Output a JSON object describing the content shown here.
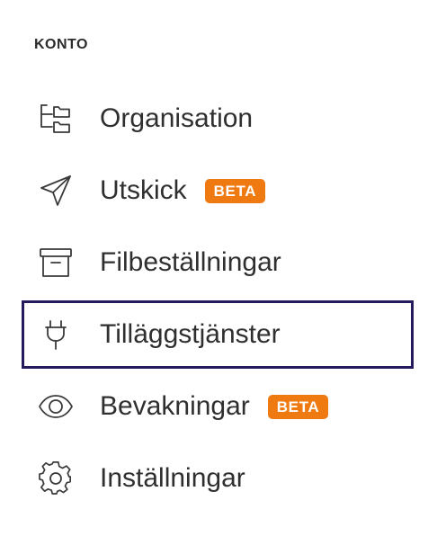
{
  "section": {
    "title": "KONTO"
  },
  "menu": {
    "items": [
      {
        "label": "Organisation",
        "icon": "folder-tree-icon",
        "badge": ""
      },
      {
        "label": "Utskick",
        "icon": "paper-plane-icon",
        "badge": "BETA"
      },
      {
        "label": "Filbeställningar",
        "icon": "archive-box-icon",
        "badge": ""
      },
      {
        "label": "Tilläggstjänster",
        "icon": "plug-icon",
        "badge": "",
        "active": true
      },
      {
        "label": "Bevakningar",
        "icon": "eye-icon",
        "badge": "BETA"
      },
      {
        "label": "Inställningar",
        "icon": "gear-icon",
        "badge": ""
      }
    ]
  },
  "colors": {
    "badge_bg": "#f07a12",
    "active_border": "#241a5c",
    "text": "#2f2f2f"
  }
}
